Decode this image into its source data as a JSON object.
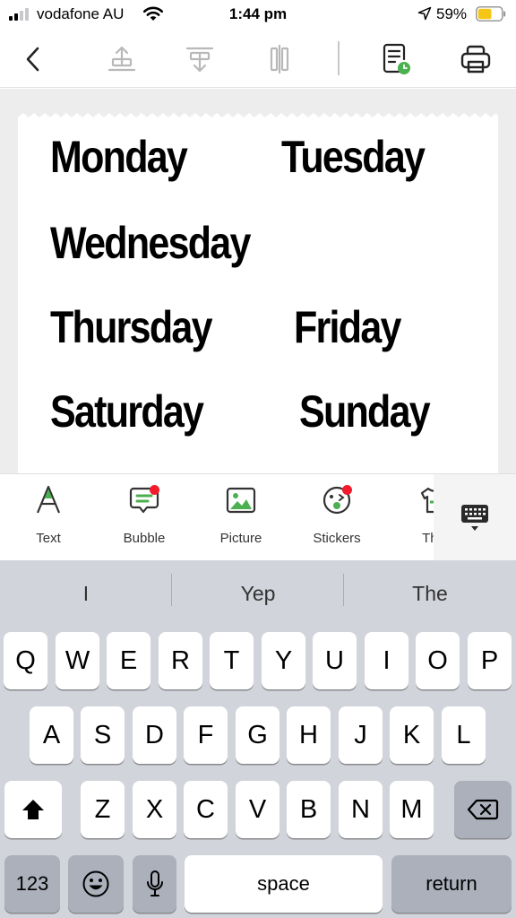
{
  "status_bar": {
    "carrier": "vodafone AU",
    "time": "1:44 pm",
    "battery_percent": "59%",
    "battery_level": 0.59,
    "signal_bars_active": 2
  },
  "toolbar": {
    "icons": [
      "back-icon",
      "align-top-icon",
      "align-bottom-icon",
      "align-center-icon",
      "label-settings-icon",
      "print-icon"
    ],
    "accent_color": "#4caf50"
  },
  "canvas": {
    "days": [
      "Monday",
      "Tuesday",
      "Wednesday",
      "Thursday",
      "Friday",
      "Saturday",
      "Sunday"
    ]
  },
  "insert_bar": {
    "items": [
      {
        "label": "Text",
        "icon": "text-icon",
        "badge": false
      },
      {
        "label": "Bubble",
        "icon": "bubble-icon",
        "badge": true
      },
      {
        "label": "Picture",
        "icon": "picture-icon",
        "badge": false
      },
      {
        "label": "Stickers",
        "icon": "sticker-icon",
        "badge": true
      },
      {
        "label": "The",
        "icon": "theme-icon",
        "badge": false
      }
    ],
    "badge_color": "#f21b2d"
  },
  "keyboard": {
    "suggestions": [
      "I",
      "Yep",
      "The"
    ],
    "row1": [
      "Q",
      "W",
      "E",
      "R",
      "T",
      "Y",
      "U",
      "I",
      "O",
      "P"
    ],
    "row2": [
      "A",
      "S",
      "D",
      "F",
      "G",
      "H",
      "J",
      "K",
      "L"
    ],
    "row3": [
      "Z",
      "X",
      "C",
      "V",
      "B",
      "N",
      "M"
    ],
    "numbers_label": "123",
    "space_label": "space",
    "return_label": "return"
  }
}
